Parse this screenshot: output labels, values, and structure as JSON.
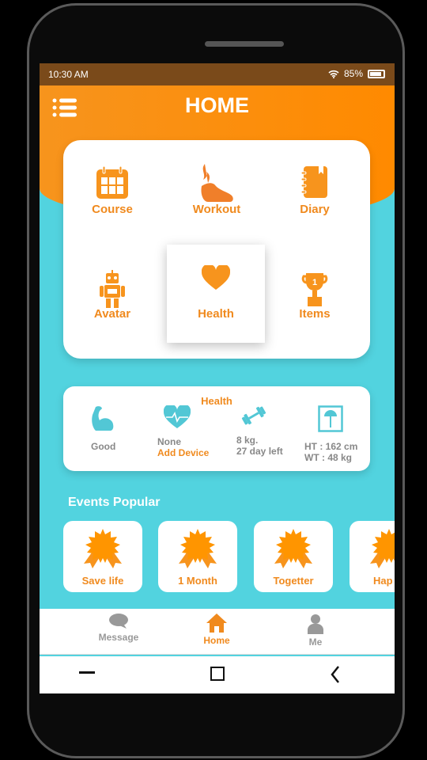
{
  "status_bar": {
    "time": "10:30 AM",
    "battery": "85%"
  },
  "header": {
    "title": "HOME"
  },
  "menu_grid": [
    {
      "label": "Course",
      "icon": "calendar-icon"
    },
    {
      "label": "Workout",
      "icon": "shoe-icon"
    },
    {
      "label": "Diary",
      "icon": "notebook-icon"
    },
    {
      "label": "Avatar",
      "icon": "robot-icon"
    },
    {
      "label": "Health",
      "icon": "heart-icon",
      "selected": true
    },
    {
      "label": "Items",
      "icon": "trophy-icon"
    }
  ],
  "health": {
    "title": "Health",
    "items": [
      {
        "line1": "Good"
      },
      {
        "line1": "None",
        "line2": "Add Device"
      },
      {
        "line1": "8 kg.",
        "line2": "27 day left"
      },
      {
        "line1": "HT : 162 cm",
        "line2": "WT : 48 kg"
      }
    ]
  },
  "events": {
    "title": "Events Popular",
    "items": [
      {
        "label": "Save life"
      },
      {
        "label": "1 Month"
      },
      {
        "label": "Togetter"
      },
      {
        "label": "Hap"
      }
    ]
  },
  "tabbar": [
    {
      "label": "Message"
    },
    {
      "label": "Home",
      "active": true
    },
    {
      "label": "Me"
    }
  ],
  "colors": {
    "accent": "#f08a1e",
    "teal": "#52d3df"
  }
}
